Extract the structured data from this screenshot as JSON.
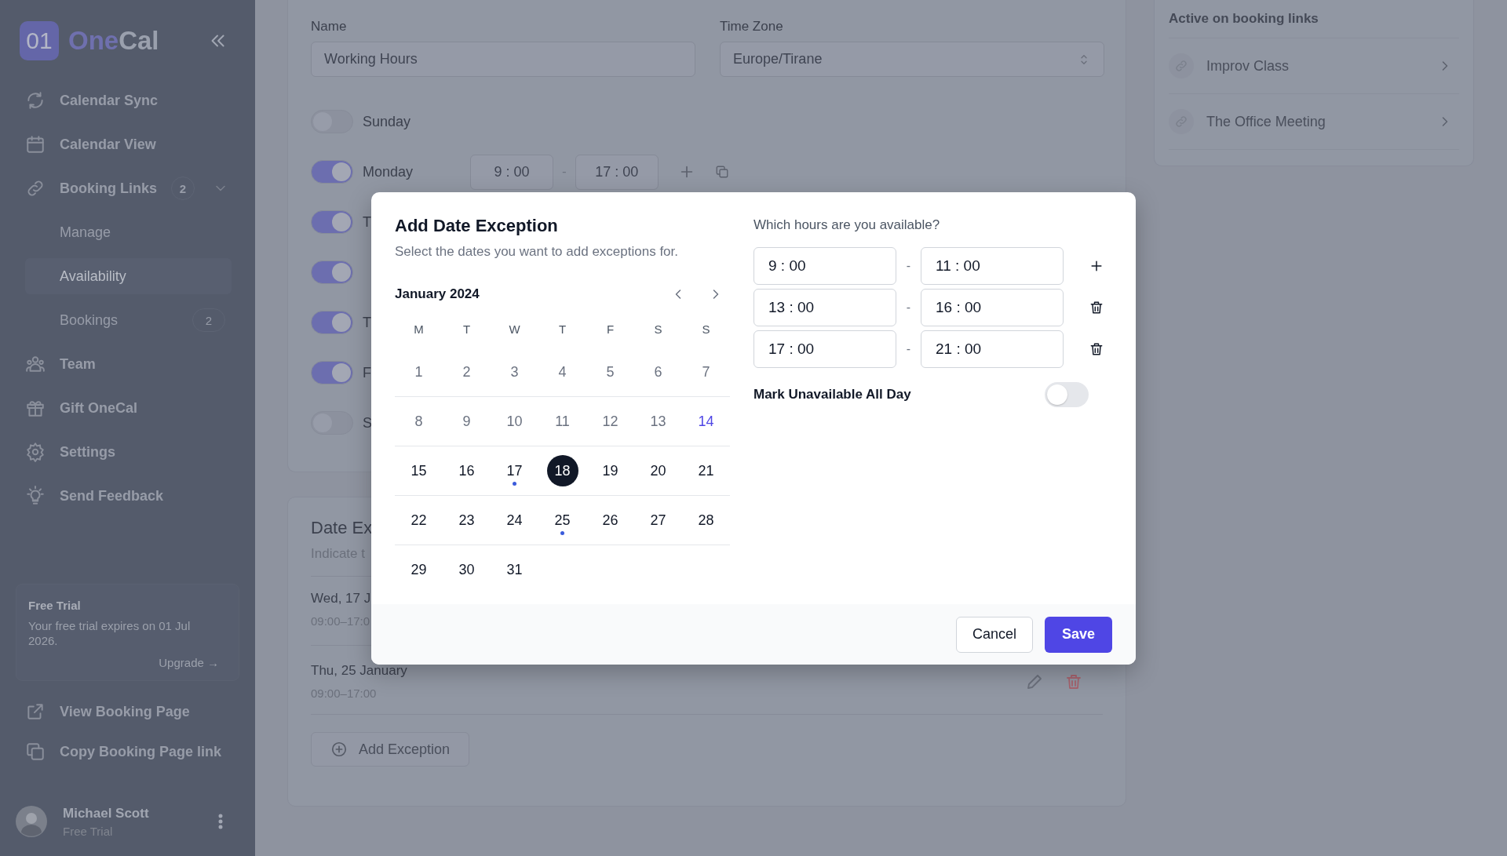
{
  "sidebar": {
    "logo": {
      "mark": "01",
      "name_first": "One",
      "name_second": "Cal"
    },
    "nav": [
      {
        "label": "Calendar Sync",
        "selected": false
      },
      {
        "label": "Calendar View",
        "selected": false
      },
      {
        "label": "Booking Links",
        "badge": "2",
        "expanded": true,
        "selected": false,
        "children": [
          {
            "label": "Manage",
            "selected": false
          },
          {
            "label": "Availability",
            "selected": true
          },
          {
            "label": "Bookings",
            "badge": "2",
            "selected": false
          }
        ]
      },
      {
        "label": "Team",
        "selected": false
      },
      {
        "label": "Gift OneCal",
        "selected": false
      },
      {
        "label": "Settings",
        "selected": false
      },
      {
        "label": "Send Feedback",
        "selected": false
      }
    ],
    "trial": {
      "title": "Free Trial",
      "text": "Your free trial expires on 01 Jul 2026.",
      "link": "Upgrade →"
    },
    "links": [
      {
        "label": "View Booking Page"
      },
      {
        "label": "Copy Booking Page link"
      }
    ],
    "user": {
      "name": "Michael Scott",
      "plan": "Free Trial"
    }
  },
  "schedule": {
    "name_label": "Name",
    "name_value": "Working Hours",
    "timezone_label": "Time Zone",
    "timezone_value": "Europe/Tirane",
    "days": [
      {
        "label": "Sunday",
        "on": false
      },
      {
        "label": "Monday",
        "on": true,
        "start": "9 : 00",
        "separator": "-",
        "end": "17 : 00"
      },
      {
        "label": "T",
        "on": true
      },
      {
        "on": true
      },
      {
        "label": "T",
        "on": true
      },
      {
        "label": "F",
        "on": true
      },
      {
        "label": "S",
        "on": false
      }
    ]
  },
  "date_exceptions": {
    "title": "Date Ex",
    "subtitle": "Indicate t",
    "add_button": "Add Exception",
    "items": [
      {
        "date": "Wed, 17 J",
        "hours": "09:00–17:0",
        "actions_visible": false
      },
      {
        "date": "Thu, 25 January",
        "hours": "09:00–17:00",
        "actions_visible": true
      }
    ]
  },
  "booking_links": {
    "title": "Active on booking links",
    "items": [
      {
        "label": "Improv Class"
      },
      {
        "label": "The Office Meeting"
      }
    ]
  },
  "modal": {
    "title": "Add Date Exception",
    "subtitle": "Select the dates you want to add exceptions for.",
    "month": "January 2024",
    "weekdays": [
      "M",
      "T",
      "W",
      "T",
      "F",
      "S",
      "S"
    ],
    "weeks": [
      [
        {
          "day": "1",
          "past": true,
          "today": false,
          "selected": false,
          "marked": false
        },
        {
          "day": "2",
          "past": true,
          "today": false,
          "selected": false,
          "marked": false
        },
        {
          "day": "3",
          "past": true,
          "today": false,
          "selected": false,
          "marked": false
        },
        {
          "day": "4",
          "past": true,
          "today": false,
          "selected": false,
          "marked": false
        },
        {
          "day": "5",
          "past": true,
          "today": false,
          "selected": false,
          "marked": false
        },
        {
          "day": "6",
          "past": true,
          "today": false,
          "selected": false,
          "marked": false
        },
        {
          "day": "7",
          "past": true,
          "today": false,
          "selected": false,
          "marked": false
        }
      ],
      [
        {
          "day": "8",
          "past": true,
          "today": false,
          "selected": false,
          "marked": false
        },
        {
          "day": "9",
          "past": true,
          "today": false,
          "selected": false,
          "marked": false
        },
        {
          "day": "10",
          "past": true,
          "today": false,
          "selected": false,
          "marked": false
        },
        {
          "day": "11",
          "past": true,
          "today": false,
          "selected": false,
          "marked": false
        },
        {
          "day": "12",
          "past": true,
          "today": false,
          "selected": false,
          "marked": false
        },
        {
          "day": "13",
          "past": true,
          "today": false,
          "selected": false,
          "marked": false
        },
        {
          "day": "14",
          "past": false,
          "today": true,
          "selected": false,
          "marked": false
        }
      ],
      [
        {
          "day": "15",
          "past": false,
          "today": false,
          "selected": false,
          "marked": false
        },
        {
          "day": "16",
          "past": false,
          "today": false,
          "selected": false,
          "marked": false
        },
        {
          "day": "17",
          "past": false,
          "today": false,
          "selected": false,
          "marked": true
        },
        {
          "day": "18",
          "past": false,
          "today": false,
          "selected": true,
          "marked": false
        },
        {
          "day": "19",
          "past": false,
          "today": false,
          "selected": false,
          "marked": false
        },
        {
          "day": "20",
          "past": false,
          "today": false,
          "selected": false,
          "marked": false
        },
        {
          "day": "21",
          "past": false,
          "today": false,
          "selected": false,
          "marked": false
        }
      ],
      [
        {
          "day": "22",
          "past": false,
          "today": false,
          "selected": false,
          "marked": false
        },
        {
          "day": "23",
          "past": false,
          "today": false,
          "selected": false,
          "marked": false
        },
        {
          "day": "24",
          "past": false,
          "today": false,
          "selected": false,
          "marked": false
        },
        {
          "day": "25",
          "past": false,
          "today": false,
          "selected": false,
          "marked": true
        },
        {
          "day": "26",
          "past": false,
          "today": false,
          "selected": false,
          "marked": false
        },
        {
          "day": "27",
          "past": false,
          "today": false,
          "selected": false,
          "marked": false
        },
        {
          "day": "28",
          "past": false,
          "today": false,
          "selected": false,
          "marked": false
        }
      ],
      [
        {
          "day": "29",
          "past": false,
          "today": false,
          "selected": false,
          "marked": false
        },
        {
          "day": "30",
          "past": false,
          "today": false,
          "selected": false,
          "marked": false
        },
        {
          "day": "31",
          "past": false,
          "today": false,
          "selected": false,
          "marked": false
        }
      ]
    ],
    "hours_label": "Which hours are you available?",
    "slots": [
      {
        "start": "9 : 00",
        "separator": "-",
        "end": "11 : 00",
        "kind": "add"
      },
      {
        "start": "13 : 00",
        "separator": "-",
        "end": "16 : 00",
        "kind": "delete"
      },
      {
        "start": "17 : 00",
        "separator": "-",
        "end": "21 : 00",
        "kind": "delete"
      }
    ],
    "unavailable_label": "Mark Unavailable All Day",
    "unavailable": false,
    "cancel": "Cancel",
    "save": "Save"
  }
}
